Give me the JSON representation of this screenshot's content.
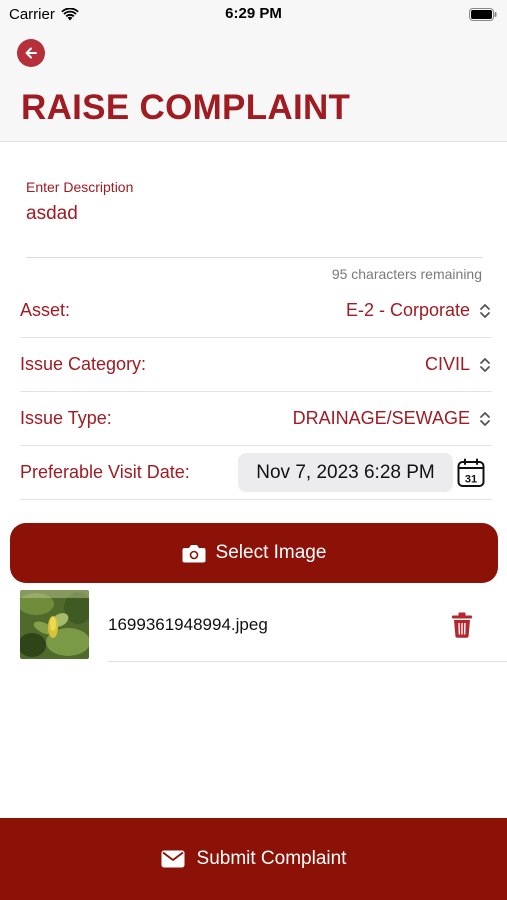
{
  "status_bar": {
    "carrier": "Carrier",
    "time": "6:29 PM"
  },
  "header": {
    "title": "RAISE COMPLAINT"
  },
  "form": {
    "description": {
      "label": "Enter Description",
      "value": "asdad",
      "remaining": "95 characters remaining"
    },
    "asset": {
      "label": "Asset:",
      "value": "E-2 - Corporate"
    },
    "issue_category": {
      "label": "Issue Category:",
      "value": "CIVIL"
    },
    "issue_type": {
      "label": "Issue Type:",
      "value": "DRAINAGE/SEWAGE"
    },
    "visit_date": {
      "label": "Preferable Visit Date:",
      "value": "Nov 7, 2023 6:28 PM",
      "calendar_day": "31"
    }
  },
  "attachments": {
    "select_label": "Select Image",
    "items": [
      {
        "file_name": "1699361948994.jpeg"
      }
    ]
  },
  "footer": {
    "submit_label": "Submit Complaint"
  },
  "colors": {
    "brand_red": "#a01b22",
    "button_dark_red": "#8c1106"
  },
  "icons": {
    "back": "arrow-left-circle-icon",
    "camera": "camera-icon",
    "trash": "trash-icon",
    "calendar": "calendar-icon",
    "mail": "mail-icon",
    "chevron": "chevron-up-down-icon"
  }
}
